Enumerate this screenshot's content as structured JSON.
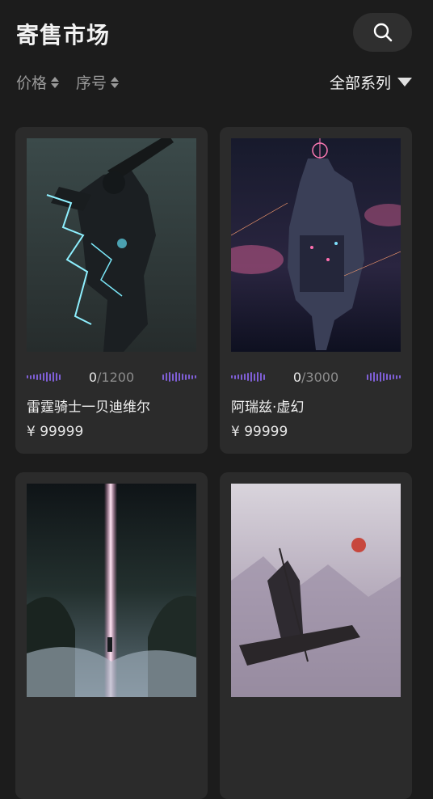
{
  "page": {
    "title": "寄售市场"
  },
  "filters": {
    "price_label": "价格",
    "serial_label": "序号",
    "series_label": "全部系列"
  },
  "cards": [
    {
      "name": "雷霆骑士一贝迪维尔",
      "sold": "0",
      "total": "/1200",
      "price": "¥ 99999"
    },
    {
      "name": "阿瑞兹·虚幻",
      "sold": "0",
      "total": "/3000",
      "price": "¥ 99999"
    },
    {
      "name": "",
      "sold": "",
      "total": "",
      "price": ""
    },
    {
      "name": "",
      "sold": "",
      "total": "",
      "price": ""
    }
  ],
  "colors": {
    "background": "#1c1c1c",
    "card": "#2b2b2b",
    "accent": "#7f5fd6"
  },
  "icons": {
    "search": "search-icon",
    "sort": "sort-arrows-icon",
    "dropdown": "caret-down-icon"
  }
}
